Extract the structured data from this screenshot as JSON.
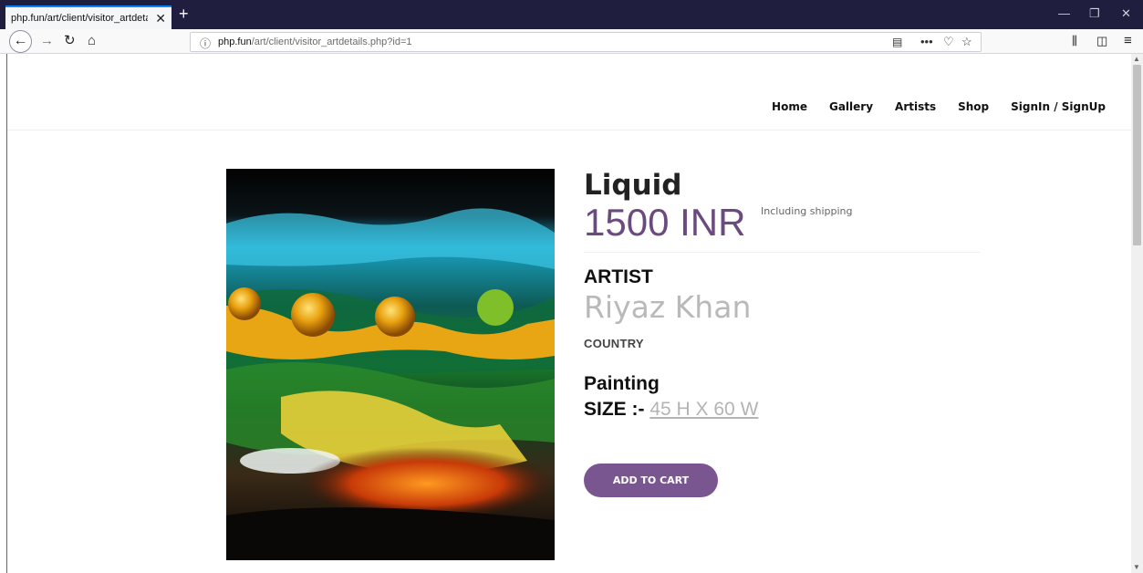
{
  "browser": {
    "tab_title": "php.fun/art/client/visitor_artdetails.",
    "tab_close": "✕",
    "new_tab": "+",
    "url_host": "php.fun",
    "url_path": "/art/client/visitor_artdetails.php?id=1",
    "window_controls": {
      "minimize": "—",
      "restore": "❐",
      "close": "✕"
    }
  },
  "nav": {
    "items": [
      "Home",
      "Gallery",
      "Artists",
      "Shop",
      "SignIn / SignUp"
    ]
  },
  "artwork": {
    "title": "Liquid",
    "price": "1500 INR",
    "shipping_note": "Including shipping",
    "artist_label": "ARTIST",
    "artist_name": "Riyaz Khan",
    "country_label": "COUNTRY",
    "category": "Painting",
    "size_label": "SIZE :-",
    "size_value": "45 H X 60 W",
    "add_to_cart": "ADD TO CART"
  },
  "colors": {
    "accent_purple": "#6b4a80",
    "button_purple": "#7a5690",
    "tabbar_dark": "#1f1e3f"
  },
  "icons": {
    "back": "back-arrow-icon",
    "forward": "forward-arrow-icon",
    "reload": "reload-icon",
    "home": "home-icon",
    "info": "info-icon",
    "reader": "reader-view-icon",
    "page_actions": "more-icon",
    "pocket": "pocket-icon",
    "bookmark": "star-icon",
    "library": "library-icon",
    "sidebar": "sidebar-icon",
    "menu": "hamburger-menu-icon"
  }
}
